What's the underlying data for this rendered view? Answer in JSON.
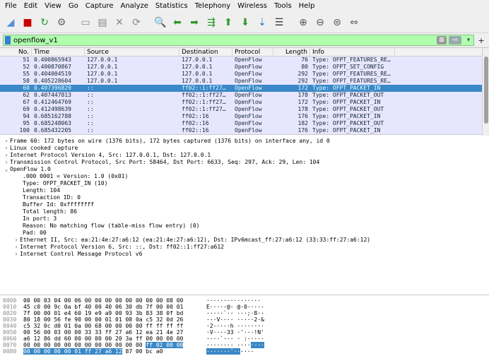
{
  "menu": [
    "File",
    "Edit",
    "View",
    "Go",
    "Capture",
    "Analyze",
    "Statistics",
    "Telephony",
    "Wireless",
    "Tools",
    "Help"
  ],
  "toolbar": {
    "icons": [
      "shark-fin-start-icon",
      "stop-icon",
      "restart-icon",
      "options-icon",
      "open-icon",
      "save-icon",
      "close-file-icon",
      "reload-icon",
      "find-icon",
      "back-icon",
      "forward-icon",
      "goto-icon",
      "first-icon",
      "last-icon",
      "autoscroll-icon",
      "colorize-icon",
      "zoom-in-icon",
      "zoom-out-icon",
      "zoom-reset-icon",
      "resize-columns-icon"
    ],
    "glyphs": [
      "◢",
      "■",
      "↻",
      "⚙",
      "▭",
      "▤",
      "✕",
      "⟳",
      "🔍",
      "⬅",
      "➡",
      "⇶",
      "⬆",
      "⬇",
      "⇣",
      "☰",
      "⊕",
      "⊖",
      "⊜",
      "⇔"
    ]
  },
  "filter": {
    "value": "openflow_v1",
    "clear_icon": "⊠",
    "apply_icon": "⇨",
    "dropdown_icon": "▾",
    "add_icon": "+"
  },
  "packet_list": {
    "columns": [
      "No.",
      "Time",
      "Source",
      "Destination",
      "Protocol",
      "Length",
      "Info"
    ],
    "rows": [
      {
        "no": "51",
        "time": "0.400865943",
        "src": "127.0.0.1",
        "dst": "127.0.0.1",
        "proto": "OpenFlow",
        "len": "76",
        "info": "Type: OFPT_FEATURES_RE…",
        "selected": false
      },
      {
        "no": "52",
        "time": "0.400870867",
        "src": "127.0.0.1",
        "dst": "127.0.0.1",
        "proto": "OpenFlow",
        "len": "80",
        "info": "Type: OFPT_SET_CONFIG",
        "selected": false
      },
      {
        "no": "55",
        "time": "0.404004519",
        "src": "127.0.0.1",
        "dst": "127.0.0.1",
        "proto": "OpenFlow",
        "len": "292",
        "info": "Type: OFPT_FEATURES_RE…",
        "selected": false
      },
      {
        "no": "58",
        "time": "0.405228604",
        "src": "127.0.0.1",
        "dst": "127.0.0.1",
        "proto": "OpenFlow",
        "len": "292",
        "info": "Type: OFPT_FEATURES_RE…",
        "selected": false
      },
      {
        "no": "60",
        "time": "0.407396829",
        "src": "::",
        "dst": "ff02::1:ff27…",
        "proto": "OpenFlow",
        "len": "172",
        "info": "Type: OFPT_PACKET_IN",
        "selected": true
      },
      {
        "no": "62",
        "time": "0.407447813",
        "src": "::",
        "dst": "ff02::1:ff27…",
        "proto": "OpenFlow",
        "len": "178",
        "info": "Type: OFPT_PACKET_OUT",
        "selected": false
      },
      {
        "no": "67",
        "time": "0.412464769",
        "src": "::",
        "dst": "ff02::1:ff27…",
        "proto": "OpenFlow",
        "len": "172",
        "info": "Type: OFPT_PACKET_IN",
        "selected": false
      },
      {
        "no": "69",
        "time": "0.412498639",
        "src": "::",
        "dst": "ff02::1:ff27…",
        "proto": "OpenFlow",
        "len": "178",
        "info": "Type: OFPT_PACKET_OUT",
        "selected": false
      },
      {
        "no": "94",
        "time": "0.685162788",
        "src": "::",
        "dst": "ff02::16",
        "proto": "OpenFlow",
        "len": "176",
        "info": "Type: OFPT_PACKET_IN",
        "selected": false
      },
      {
        "no": "95",
        "time": "0.685248063",
        "src": "::",
        "dst": "ff02::16",
        "proto": "OpenFlow",
        "len": "182",
        "info": "Type: OFPT_PACKET_OUT",
        "selected": false
      },
      {
        "no": "100",
        "time": "0.685432205",
        "src": "::",
        "dst": "ff02::16",
        "proto": "OpenFlow",
        "len": "176",
        "info": "Type: OFPT_PACKET_IN",
        "selected": false
      }
    ]
  },
  "details": [
    {
      "level": "l1",
      "arrow": "›",
      "text": "Frame 60: 172 bytes on wire (1376 bits), 172 bytes captured (1376 bits) on interface any, id 0"
    },
    {
      "level": "l1",
      "arrow": "›",
      "text": "Linux cooked capture"
    },
    {
      "level": "l1",
      "arrow": "›",
      "text": "Internet Protocol Version 4, Src: 127.0.0.1, Dst: 127.0.0.1"
    },
    {
      "level": "l1",
      "arrow": "›",
      "text": "Transmission Control Protocol, Src Port: 58464, Dst Port: 6633, Seq: 297, Ack: 29, Len: 104"
    },
    {
      "level": "l1",
      "arrow": "⌄",
      "text": "OpenFlow 1.0"
    },
    {
      "level": "l2",
      "arrow": "",
      "text": ".000 0001 = Version: 1.0 (0x01)"
    },
    {
      "level": "l2",
      "arrow": "",
      "text": "Type: OFPT_PACKET_IN (10)"
    },
    {
      "level": "l2",
      "arrow": "",
      "text": "Length: 104"
    },
    {
      "level": "l2",
      "arrow": "",
      "text": "Transaction ID: 0"
    },
    {
      "level": "l2",
      "arrow": "",
      "text": "Buffer Id: 0xffffffff"
    },
    {
      "level": "l2",
      "arrow": "",
      "text": "Total length: 86"
    },
    {
      "level": "l2",
      "arrow": "",
      "text": "In port: 3"
    },
    {
      "level": "l2",
      "arrow": "",
      "text": "Reason: No matching flow (table-miss flow entry) (0)"
    },
    {
      "level": "l2",
      "arrow": "",
      "text": "Pad: 00"
    },
    {
      "level": "l2x",
      "arrow": "›",
      "text": "Ethernet II, Src: ea:21:4e:27:a6:12 (ea:21:4e:27:a6:12), Dst: IPv6mcast_ff:27:a6:12 (33:33:ff:27:a6:12)"
    },
    {
      "level": "l2x",
      "arrow": "›",
      "text": "Internet Protocol Version 6, Src: ::, Dst: ff02::1:ff27:a612"
    },
    {
      "level": "l2x",
      "arrow": "›",
      "text": "Internet Control Message Protocol v6"
    }
  ],
  "bytes": [
    {
      "off": "0000",
      "hex": "00 00 03 04 00 06 00 00  00 00 00 00 00 00 08 00",
      "asc": "················"
    },
    {
      "off": "0010",
      "hex": "45 c0 00 9c 0a bf 40 00  40 06 30 db 7f 00 00 01",
      "asc": "E·····@· @·0·····"
    },
    {
      "off": "0020",
      "hex": "7f 00 00 01 e4 60 19 e9  a9 00 93 3b 83 38 0f bd",
      "asc": "·····`·· ···;·8··"
    },
    {
      "off": "0030",
      "hex": "80 18 00 56 fe 90 00 00  01 01 08 0a c5 32 0d 26",
      "asc": "···V···· ·····2·&"
    },
    {
      "off": "0040",
      "hex": "c5 32 0c d0 01 0a 00 68  00 00 00 00 ff ff ff ff",
      "asc": "·2·····h ········"
    },
    {
      "off": "0050",
      "hex": "00 56 00 03 00 00 33 33  ff 27 a6 12 ea 21 4e 27",
      "asc": "·V····33 ·'···!N'"
    },
    {
      "off": "0060",
      "hex": "a6 12 86 dd 60 00 00 00  00 20 3a ff 00 00 00 00",
      "asc": "····`··· · :·····"
    },
    {
      "off": "0070",
      "hex": "00 00 00 00 00 00 00 00  00 00 00 00 ",
      "hex_hl": "ff 02 00 00",
      "asc": "········ ····",
      "asc_hl": "····"
    },
    {
      "off": "0080",
      "hex": "",
      "hex_hl": "00 00 00 00 00 01 ff 27  a6 12",
      "hex_tail": " 87 00 bc a0",
      "asc": "",
      "asc_hl": "·······'··",
      "asc_tail": "····"
    }
  ]
}
